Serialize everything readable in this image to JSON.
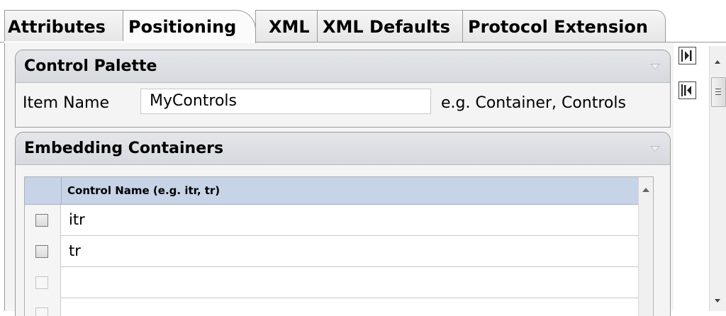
{
  "tabs": [
    {
      "label": "Attributes"
    },
    {
      "label": "Positioning"
    },
    {
      "label": "XML"
    },
    {
      "label": "XML Defaults"
    },
    {
      "label": "Protocol Extension"
    }
  ],
  "active_tab": "Positioning",
  "control_palette": {
    "title": "Control Palette",
    "item_name_label": "Item Name",
    "item_name_value": "MyControls",
    "hint": "e.g. Container, Controls"
  },
  "embedding_containers": {
    "title": "Embedding Containers",
    "column_header": "Control Name (e.g. itr, tr)",
    "rows": [
      {
        "name": "itr"
      },
      {
        "name": "tr"
      },
      {
        "name": ""
      },
      {
        "name": ""
      }
    ]
  },
  "icons": [
    "collapse-panel-icon",
    "move-last-icon",
    "move-first-icon",
    "checkbox-icon"
  ],
  "colors": {
    "table_header": "#c7d3e6",
    "panel_header": "#d6d9de"
  }
}
